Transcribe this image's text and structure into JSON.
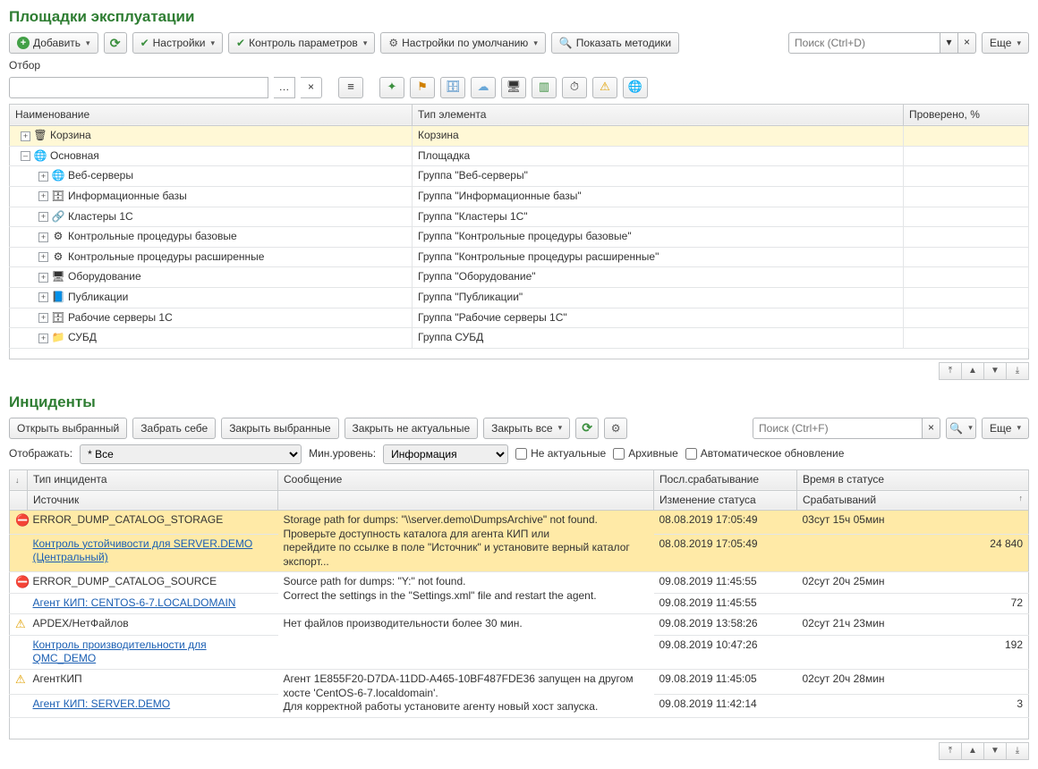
{
  "titles": {
    "main": "Площадки эксплуатации",
    "incidents": "Инциденты"
  },
  "toolbar": {
    "add": "Добавить",
    "settings": "Настройки",
    "paramControl": "Контроль параметров",
    "defaults": "Настройки по умолчанию",
    "showMethods": "Показать методики",
    "searchPlaceholder": "Поиск (Ctrl+D)",
    "more": "Еще"
  },
  "filter": {
    "label": "Отбор"
  },
  "treeHeaders": {
    "name": "Наименование",
    "type": "Тип элемента",
    "checked": "Проверено, %"
  },
  "tree": [
    {
      "lvl": 1,
      "exp": "+",
      "icon": "🗑",
      "name": "Корзина",
      "type": "Корзина",
      "sel": true
    },
    {
      "lvl": 1,
      "exp": "–",
      "icon": "🌐",
      "name": "Основная",
      "type": "Площадка"
    },
    {
      "lvl": 2,
      "exp": "+",
      "icon": "🌐",
      "name": "Веб-серверы",
      "type": "Группа \"Веб-серверы\""
    },
    {
      "lvl": 2,
      "exp": "+",
      "icon": "🗄",
      "name": "Информационные базы",
      "type": "Группа \"Информационные базы\""
    },
    {
      "lvl": 2,
      "exp": "+",
      "icon": "🔗",
      "name": "Кластеры 1С",
      "type": "Группа \"Кластеры 1С\""
    },
    {
      "lvl": 2,
      "exp": "+",
      "icon": "⚙",
      "name": "Контрольные процедуры базовые",
      "type": "Группа \"Контрольные процедуры базовые\""
    },
    {
      "lvl": 2,
      "exp": "+",
      "icon": "⚙",
      "name": "Контрольные процедуры расширенные",
      "type": "Группа \"Контрольные процедуры расширенные\""
    },
    {
      "lvl": 2,
      "exp": "+",
      "icon": "🖥",
      "name": "Оборудование",
      "type": "Группа \"Оборудование\""
    },
    {
      "lvl": 2,
      "exp": "+",
      "icon": "📘",
      "name": "Публикации",
      "type": "Группа \"Публикации\""
    },
    {
      "lvl": 2,
      "exp": "+",
      "icon": "🗄",
      "name": "Рабочие серверы 1С",
      "type": "Группа \"Рабочие серверы 1С\""
    },
    {
      "lvl": 2,
      "exp": "+",
      "icon": "📁",
      "name": "СУБД",
      "type": "Группа СУБД"
    }
  ],
  "incToolbar": {
    "openSelected": "Открыть выбранный",
    "takeSelf": "Забрать себе",
    "closeSelected": "Закрыть выбранные",
    "closeOutdated": "Закрыть не актуальные",
    "closeAll": "Закрыть все",
    "searchPlaceholder": "Поиск (Ctrl+F)",
    "more": "Еще"
  },
  "incFilters": {
    "showLabel": "Отображать:",
    "showValue": "* Все",
    "minLevelLabel": "Мин.уровень:",
    "minLevelValue": "Информация",
    "notActual": "Не актуальные",
    "archived": "Архивные",
    "autoRefresh": "Автоматическое обновление"
  },
  "incHeaders": {
    "type": "Тип инцидента",
    "msg": "Сообщение",
    "lastTrigger": "Посл.срабатывание",
    "timeInStatus": "Время в статусе",
    "source": "Источник",
    "statusChange": "Изменение статуса",
    "triggers": "Срабатываний"
  },
  "incidents": [
    {
      "sel": true,
      "sev": "err",
      "type": "ERROR_DUMP_CATALOG_STORAGE",
      "source": "Контроль устойчивости для SERVER.DEMO (Центральный)",
      "msg": "Storage path for dumps: \"\\\\server.demo\\DumpsArchive\" not found.\nПроверьте доступность каталога для агента КИП или\nперейдите по ссылке в поле \"Источник\" и установите верный каталог экспорт...",
      "lastTrigger": "08.08.2019 17:05:49",
      "statusChange": "08.08.2019 17:05:49",
      "timeInStatus": "03сут 15ч 05мин",
      "triggers": "24 840"
    },
    {
      "sev": "err",
      "type": "ERROR_DUMP_CATALOG_SOURCE",
      "source": "Агент КИП: CENTOS-6-7.LOCALDOMAIN",
      "msg": "Source path for dumps: \"Y:\" not found.\nCorrect the settings in the \"Settings.xml\" file and restart the agent.",
      "lastTrigger": "09.08.2019 11:45:55",
      "statusChange": "09.08.2019 11:45:55",
      "timeInStatus": "02сут 20ч 25мин",
      "triggers": "72"
    },
    {
      "sev": "warn",
      "type": "APDEX/НетФайлов",
      "source": "Контроль производительности для QMC_DEMO",
      "msg": "Нет файлов производительности более 30 мин.",
      "lastTrigger": "09.08.2019 13:58:26",
      "statusChange": "09.08.2019 10:47:26",
      "timeInStatus": "02сут 21ч 23мин",
      "triggers": "192"
    },
    {
      "sev": "warn",
      "type": "АгентКИП",
      "source": "Агент КИП: SERVER.DEMO",
      "msg": "Агент  1E855F20-D7DA-11DD-A465-10BF487FDE36 запущен на другом хосте 'CentOS-6-7.localdomain'.\nДля корректной работы установите агенту новый хост запуска.",
      "lastTrigger": "09.08.2019 11:45:05",
      "statusChange": "09.08.2019 11:42:14",
      "timeInStatus": "02сут 20ч 28мин",
      "triggers": "3"
    }
  ]
}
